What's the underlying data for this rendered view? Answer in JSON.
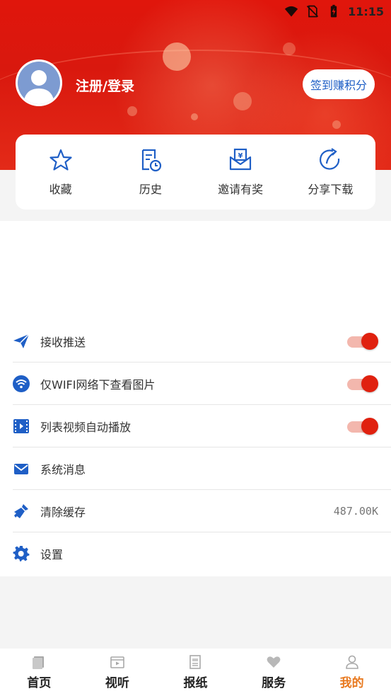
{
  "status_bar": {
    "time": "11:15"
  },
  "header": {
    "login_text": "注册/登录",
    "checkin_button": "签到赚积分"
  },
  "quick_actions": [
    {
      "icon": "star-icon",
      "label": "收藏"
    },
    {
      "icon": "history-icon",
      "label": "历史"
    },
    {
      "icon": "invite-envelope-icon",
      "label": "邀请有奖"
    },
    {
      "icon": "share-icon",
      "label": "分享下载"
    }
  ],
  "settings": [
    {
      "icon": "paper-plane-icon",
      "label": "接收推送",
      "toggle_on": true
    },
    {
      "icon": "wifi-icon",
      "label": "仅WIFI网络下查看图片",
      "toggle_on": true
    },
    {
      "icon": "video-icon",
      "label": "列表视频自动播放",
      "toggle_on": true
    },
    {
      "icon": "message-icon",
      "label": "系统消息"
    },
    {
      "icon": "broom-icon",
      "label": "清除缓存",
      "value": "487.00K"
    },
    {
      "icon": "gear-icon",
      "label": "设置"
    }
  ],
  "bottom_nav": [
    {
      "icon": "home-icon",
      "label": "首页",
      "active": false
    },
    {
      "icon": "video-film-icon",
      "label": "视听",
      "active": false
    },
    {
      "icon": "newspaper-icon",
      "label": "报纸",
      "active": false
    },
    {
      "icon": "heart-icon",
      "label": "服务",
      "active": false
    },
    {
      "icon": "person-icon",
      "label": "我的",
      "active": true
    }
  ],
  "colors": {
    "header_red": "#d9180e",
    "icon_blue": "#1f5fc6",
    "toggle_red": "#e0210f",
    "nav_active": "#e8791f"
  }
}
